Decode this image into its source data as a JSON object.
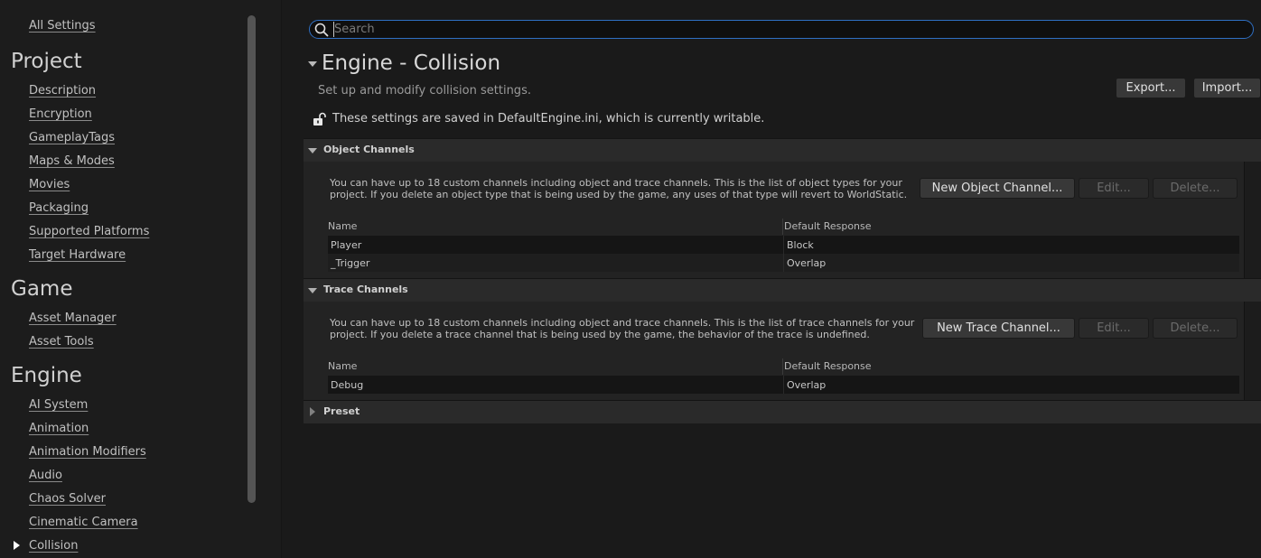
{
  "sidebar": {
    "all_settings": "All Settings",
    "categories": [
      {
        "title": "Project",
        "items": [
          "Description",
          "Encryption",
          "GameplayTags",
          "Maps & Modes",
          "Movies",
          "Packaging",
          "Supported Platforms",
          "Target Hardware"
        ]
      },
      {
        "title": "Game",
        "items": [
          "Asset Manager",
          "Asset Tools"
        ]
      },
      {
        "title": "Engine",
        "items": [
          "AI System",
          "Animation",
          "Animation Modifiers",
          "Audio",
          "Chaos Solver",
          "Cinematic Camera",
          "Collision"
        ]
      }
    ],
    "selected_item": "Collision"
  },
  "search": {
    "placeholder": "Search",
    "value": ""
  },
  "section": {
    "title": "Engine - Collision",
    "description": "Set up and modify collision settings.",
    "export_label": "Export...",
    "import_label": "Import...",
    "writable_note": "These settings are saved in DefaultEngine.ini, which is currently writable."
  },
  "object_channels": {
    "label": "Object Channels",
    "description": "You can have up to 18 custom channels including object and trace channels. This is the list of object types for your project. If you delete an object type that is being used by the game, any uses of that type will revert to WorldStatic.",
    "new_label": "New Object Channel...",
    "edit_label": "Edit...",
    "delete_label": "Delete...",
    "columns": [
      "Name",
      "Default Response"
    ],
    "rows": [
      {
        "name": "Player",
        "response": "Block"
      },
      {
        "name": "_Trigger",
        "response": "Overlap"
      }
    ]
  },
  "trace_channels": {
    "label": "Trace Channels",
    "description": "You can have up to 18 custom channels including object and trace channels. This is the list of trace channels for your project. If you delete a trace channel that is being used by the game, the behavior of the trace is undefined.",
    "new_label": "New Trace Channel...",
    "edit_label": "Edit...",
    "delete_label": "Delete...",
    "columns": [
      "Name",
      "Default Response"
    ],
    "rows": [
      {
        "name": "Debug",
        "response": "Overlap"
      }
    ]
  },
  "preset": {
    "label": "Preset"
  },
  "colors": {
    "accent": "#2f6fc3",
    "background": "#1a1a1a",
    "panel": "#2a2a2a"
  },
  "icons": {
    "search": "search-icon",
    "lock": "unlocked-padlock-icon",
    "expanded": "triangle-down-icon",
    "collapsed": "triangle-right-icon"
  }
}
